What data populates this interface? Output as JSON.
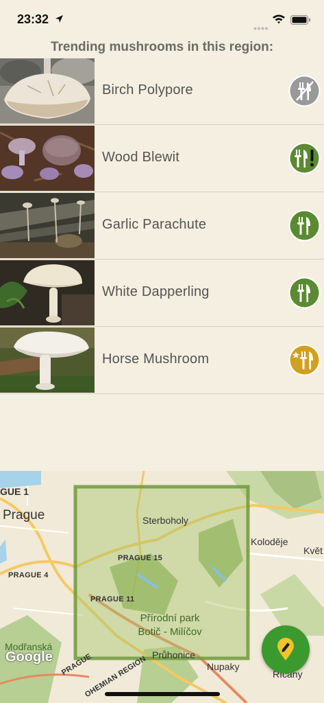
{
  "status_bar": {
    "time": "23:32"
  },
  "section_title": "Trending mushrooms in this region:",
  "mushrooms": [
    {
      "name": "Birch Polypore",
      "edibility_icon": "inedible-crossed-fork-knife-icon",
      "badge_color": "#9a9a9a"
    },
    {
      "name": "Wood Blewit",
      "edibility_icon": "edible-caution-fork-knife-icon",
      "badge_color": "#5a8a32"
    },
    {
      "name": "Garlic Parachute",
      "edibility_icon": "edible-fork-knife-icon",
      "badge_color": "#5a8a32"
    },
    {
      "name": "White Dapperling",
      "edibility_icon": "edible-fork-knife-icon",
      "badge_color": "#5a8a32"
    },
    {
      "name": "Horse Mushroom",
      "edibility_icon": "choice-edible-star-fork-knife-icon",
      "badge_color": "#d2a020"
    }
  ],
  "map": {
    "labels": {
      "prague_1": "GUE 1",
      "prague": "Prague",
      "prague_4": "PRAGUE 4",
      "prague_15": "PRAGUE 15",
      "prague_11": "PRAGUE 11",
      "sterboholy": "Sterboholy",
      "kolodeje": "Koloděje",
      "kvet": "Květ",
      "park_line1": "Přírodní park",
      "park_line2": "Botič - Milíčov",
      "pruhonice": "Průhonice",
      "nupaky": "Nupaky",
      "ricany": "Říčany",
      "modranska": "Modřanská",
      "prague_road": "PRAGUE",
      "bohemian_region": "OHEMIAN REGION"
    },
    "attribution": "Google"
  },
  "fab": {
    "icon": "pencil-location-icon",
    "color": "#3a9a2e"
  }
}
